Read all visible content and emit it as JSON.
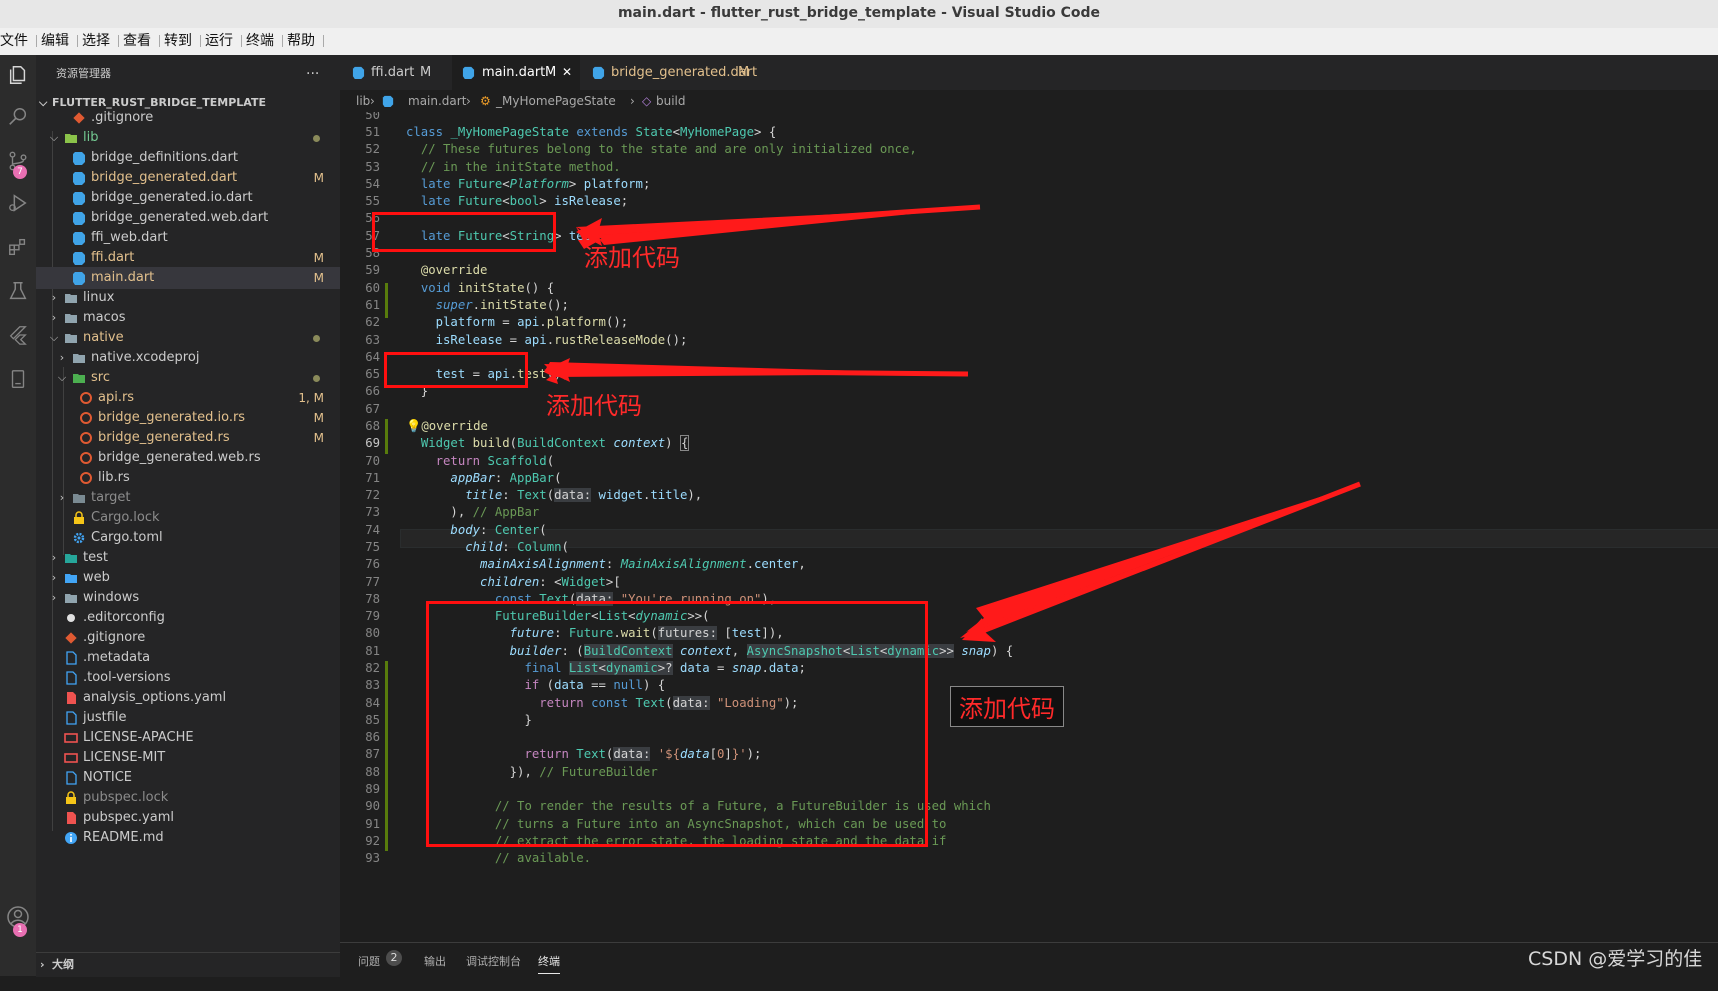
{
  "window": {
    "title": "main.dart - flutter_rust_bridge_template - Visual Studio Code"
  },
  "menu": [
    "文件",
    "编辑",
    "选择",
    "查看",
    "转到",
    "运行",
    "终端",
    "帮助"
  ],
  "activity_bar": {
    "scm_badge": "7",
    "account_badge": "1"
  },
  "sidebar": {
    "title": "资源管理器",
    "more": "···",
    "folder": "FLUTTER_RUST_BRIDGE_TEMPLATE",
    "items": [
      {
        "label": ".gitignore",
        "status": "",
        "color": "#cccccc"
      },
      {
        "label": "lib",
        "status": "",
        "color": "#73c991"
      },
      {
        "label": "bridge_definitions.dart",
        "status": "",
        "color": "#cccccc"
      },
      {
        "label": "bridge_generated.dart",
        "status": "M",
        "color": "#e2c08d"
      },
      {
        "label": "bridge_generated.io.dart",
        "status": "",
        "color": "#cccccc"
      },
      {
        "label": "bridge_generated.web.dart",
        "status": "",
        "color": "#cccccc"
      },
      {
        "label": "ffi_web.dart",
        "status": "",
        "color": "#cccccc"
      },
      {
        "label": "ffi.dart",
        "status": "M",
        "color": "#e2c08d"
      },
      {
        "label": "main.dart",
        "status": "M",
        "color": "#e2c08d"
      },
      {
        "label": "linux",
        "status": "",
        "color": "#cccccc"
      },
      {
        "label": "macos",
        "status": "",
        "color": "#cccccc"
      },
      {
        "label": "native",
        "status": "",
        "color": "#e2c08d"
      },
      {
        "label": "native.xcodeproj",
        "status": "",
        "color": "#cccccc"
      },
      {
        "label": "src",
        "status": "",
        "color": "#e2c08d"
      },
      {
        "label": "api.rs",
        "status": "1, M",
        "color": "#e2c08d"
      },
      {
        "label": "bridge_generated.io.rs",
        "status": "M",
        "color": "#e2c08d"
      },
      {
        "label": "bridge_generated.rs",
        "status": "M",
        "color": "#e2c08d"
      },
      {
        "label": "bridge_generated.web.rs",
        "status": "",
        "color": "#cccccc"
      },
      {
        "label": "lib.rs",
        "status": "",
        "color": "#cccccc"
      },
      {
        "label": "target",
        "status": "",
        "color": "#8c8c8c"
      },
      {
        "label": "Cargo.lock",
        "status": "",
        "color": "#8c8c8c"
      },
      {
        "label": "Cargo.toml",
        "status": "",
        "color": "#cccccc"
      },
      {
        "label": "test",
        "status": "",
        "color": "#cccccc"
      },
      {
        "label": "web",
        "status": "",
        "color": "#cccccc"
      },
      {
        "label": "windows",
        "status": "",
        "color": "#cccccc"
      },
      {
        "label": ".editorconfig",
        "status": "",
        "color": "#cccccc"
      },
      {
        "label": ".gitignore",
        "status": "",
        "color": "#cccccc"
      },
      {
        "label": ".metadata",
        "status": "",
        "color": "#cccccc"
      },
      {
        "label": ".tool-versions",
        "status": "",
        "color": "#cccccc"
      },
      {
        "label": "analysis_options.yaml",
        "status": "",
        "color": "#cccccc"
      },
      {
        "label": "justfile",
        "status": "",
        "color": "#cccccc"
      },
      {
        "label": "LICENSE-APACHE",
        "status": "",
        "color": "#cccccc"
      },
      {
        "label": "LICENSE-MIT",
        "status": "",
        "color": "#cccccc"
      },
      {
        "label": "NOTICE",
        "status": "",
        "color": "#cccccc"
      },
      {
        "label": "pubspec.lock",
        "status": "",
        "color": "#8c8c8c"
      },
      {
        "label": "pubspec.yaml",
        "status": "",
        "color": "#cccccc"
      },
      {
        "label": "README.md",
        "status": "",
        "color": "#cccccc"
      }
    ],
    "outline": "大纲"
  },
  "tabs": [
    {
      "label": "ffi.dart",
      "status": "M"
    },
    {
      "label": "main.dart",
      "status": "M",
      "close": "✕"
    },
    {
      "label": "bridge_generated.dart",
      "status": "M"
    }
  ],
  "breadcrumb": [
    "lib",
    "main.dart",
    "_MyHomePageState",
    "build"
  ],
  "line_numbers": [
    "50",
    "51",
    "52",
    "53",
    "54",
    "55",
    "56",
    "57",
    "58",
    "59",
    "60",
    "61",
    "62",
    "63",
    "64",
    "65",
    "66",
    "67",
    "68",
    "69",
    "70",
    "71",
    "72",
    "73",
    "74",
    "75",
    "76",
    "77",
    "78",
    "79",
    "80",
    "81",
    "82",
    "83",
    "84",
    "85",
    "86",
    "87",
    "88",
    "89",
    "90",
    "91",
    "92",
    "93"
  ],
  "annotations": [
    "添加代码",
    "添加代码",
    "添加代码"
  ],
  "panel_tabs": {
    "problems": "问题",
    "problems_count": "2",
    "output": "输出",
    "debug_console": "调试控制台",
    "terminal": "终端"
  },
  "watermark": "CSDN @爱学习的佳"
}
